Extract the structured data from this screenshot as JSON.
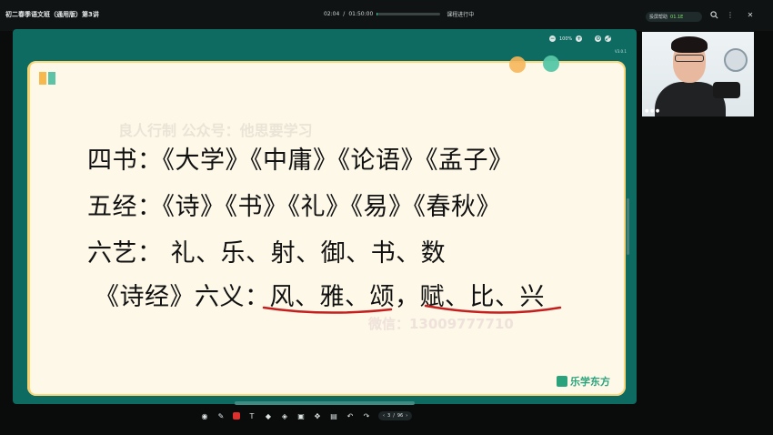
{
  "window": {
    "course_title": "初二春季语文班（通用版）第3讲",
    "time_current": "02:04",
    "time_separator": "/",
    "time_total": "01:50:00",
    "progress_fraction": 0.01,
    "status_text": "课程进行中",
    "network_label": "投屏帮助",
    "network_speed": "01.1E",
    "icons": [
      "search-icon",
      "more-icon",
      "close-icon"
    ]
  },
  "panel": {
    "zoom": "100%",
    "page_id": "V3.0.1"
  },
  "slide": {
    "watermark_1": "良人行制 公众号：他思要学习",
    "watermark_2": "微信：13009777710",
    "lines": [
      "四书：《大学》《中庸》《论语》《孟子》",
      "五经：《诗》《书》《礼》《易》《春秋》",
      "六艺：  礼、乐、射、御、书、数",
      "《诗经》六义：风、雅、颂，赋、比、兴"
    ],
    "brand": "乐学东方"
  },
  "toolbar": {
    "page_current": "3",
    "page_separator": "/",
    "page_total": "96",
    "icons": [
      "record-icon",
      "pen-icon",
      "color-red-icon",
      "text-icon",
      "shape-icon",
      "eraser-icon",
      "screenshot-icon",
      "move-icon",
      "delete-icon",
      "undo-icon",
      "redo-icon",
      "prev-page-icon",
      "next-page-icon"
    ]
  },
  "colors": {
    "panel_bg": "#0d6b62",
    "slide_bg": "#fdf8e8",
    "underline_red": "#c41f1f",
    "brand_green": "#2aa37d"
  }
}
